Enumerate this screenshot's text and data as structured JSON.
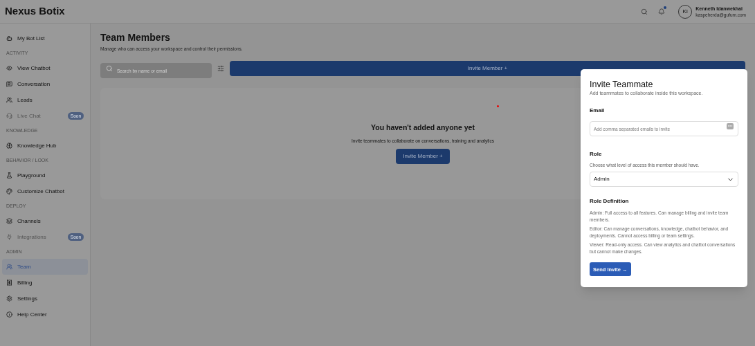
{
  "app": {
    "title": "Nexus Botix"
  },
  "header": {
    "notification_unread": true,
    "user": {
      "initials": "KI",
      "name": "Kenneth Idanwekhai",
      "email": "kaspeherda@gufum.com"
    }
  },
  "sidebar": {
    "items": [
      {
        "kind": "item",
        "label": "My Bot List",
        "selected": false,
        "disabled": false
      },
      {
        "kind": "section",
        "label": "ACTIVITY"
      },
      {
        "kind": "item",
        "label": "View Chatbot",
        "selected": false,
        "disabled": false
      },
      {
        "kind": "item",
        "label": "Conversation",
        "selected": false,
        "disabled": false
      },
      {
        "kind": "item",
        "label": "Leads",
        "selected": false,
        "disabled": false
      },
      {
        "kind": "item",
        "label": "Live Chat",
        "selected": false,
        "disabled": true,
        "badge": "Soon"
      },
      {
        "kind": "section",
        "label": "KNOWLEDGE"
      },
      {
        "kind": "item",
        "label": "Knowledge Hub",
        "selected": false,
        "disabled": false
      },
      {
        "kind": "section",
        "label": "BEHAVIOR / LOOK"
      },
      {
        "kind": "item",
        "label": "Playground",
        "selected": false,
        "disabled": false
      },
      {
        "kind": "item",
        "label": "Customize Chatbot",
        "selected": false,
        "disabled": false
      },
      {
        "kind": "section",
        "label": "DEPLOY"
      },
      {
        "kind": "item",
        "label": "Channels",
        "selected": false,
        "disabled": false
      },
      {
        "kind": "item",
        "label": "Integrations",
        "selected": false,
        "disabled": true,
        "badge": "Soon"
      },
      {
        "kind": "section",
        "label": "ADMIN"
      },
      {
        "kind": "item",
        "label": "Team",
        "selected": true,
        "disabled": false
      },
      {
        "kind": "item",
        "label": "Billing",
        "selected": false,
        "disabled": false
      },
      {
        "kind": "item",
        "label": "Settings",
        "selected": false,
        "disabled": false
      },
      {
        "kind": "item",
        "label": "Help Center",
        "selected": false,
        "disabled": false
      }
    ]
  },
  "page": {
    "title": "Team Members",
    "subtitle": "Manage who can access your workspace and control their permissions.",
    "search": {
      "placeholder": "Search by name or email"
    },
    "invite_button": "Invite Member +",
    "empty_state": {
      "title": "You haven't added anyone yet",
      "text": "Invite teammates to collaborate on conversations, training and analytics",
      "button": "Invite Member +"
    }
  },
  "dialog": {
    "title": "Invite Teammate",
    "subtitle": "Add teammates to collaborate inside this workspace.",
    "email": {
      "label": "Email",
      "placeholder": "Add comma separated emails to invite"
    },
    "role": {
      "label": "Role",
      "hint": "Choose what level of access this member should have.",
      "value": "Admin"
    },
    "definitions": {
      "title": "Role Definition",
      "items": [
        "Admin: Full access to all features. Can manage billing and invite team members.",
        "Editor: Can manage conversations, knowledge, chatbot behavior, and deployments. Cannot access billing or team settings.",
        "Viewer: Read-only access. Can view analytics and chatbot conversations but cannot make changes."
      ]
    },
    "submit": "Send Invite →"
  }
}
